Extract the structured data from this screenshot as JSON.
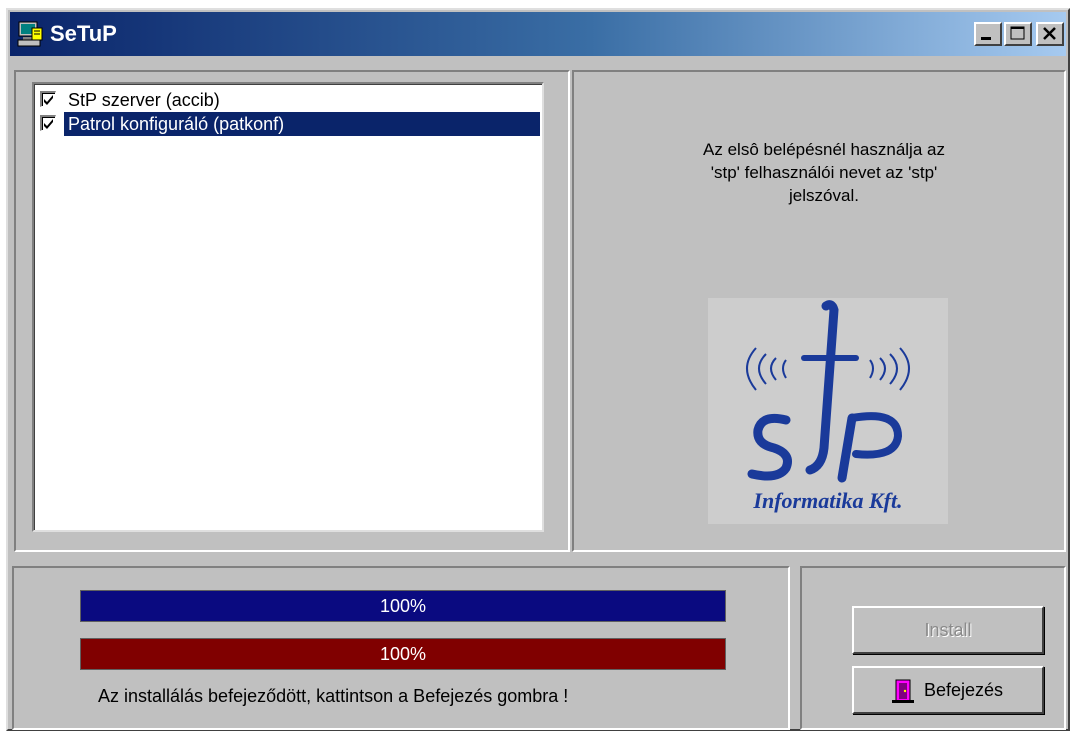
{
  "window": {
    "title": "SeTuP",
    "controls": {
      "minimize": "minimize-icon",
      "maximize": "maximize-icon",
      "close": "close-icon"
    }
  },
  "components": {
    "items": [
      {
        "label": "StP szerver (accib)",
        "checked": true,
        "selected": false
      },
      {
        "label": "Patrol konfiguráló (patkonf)",
        "checked": true,
        "selected": true
      }
    ]
  },
  "info": {
    "line1": "Az elsô belépésnél használja az",
    "line2": "'stp' felhasználói nevet az 'stp'",
    "line3": "jelszóval."
  },
  "logo": {
    "text": "stP",
    "subtitle": "Informatika Kft."
  },
  "progress": {
    "bar1": {
      "label": "100%",
      "value": 100,
      "color": "#0a0a80"
    },
    "bar2": {
      "label": "100%",
      "value": 100,
      "color": "#800000"
    },
    "status": "Az  installálás befejeződött, kattintson a Befejezés gombra !"
  },
  "buttons": {
    "install": {
      "label": "Install",
      "enabled": false
    },
    "finish": {
      "label": "Befejezés",
      "icon": "exit-door-icon"
    }
  },
  "colors": {
    "face": "#c0c0c0",
    "selection": "#0a246a",
    "title_start": "#0a246a",
    "title_end": "#a6caf0"
  }
}
